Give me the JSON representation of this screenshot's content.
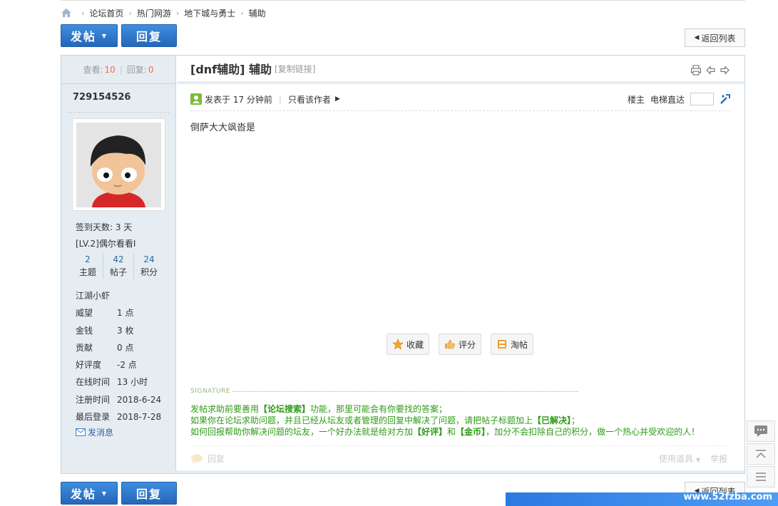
{
  "breadcrumb": [
    "论坛首页",
    "热门网游",
    "地下城与勇士",
    "辅助"
  ],
  "toolbar": {
    "post_label": "发帖",
    "reply_label": "回复",
    "back_label": "返回列表"
  },
  "stats": {
    "views_label": "查看:",
    "views": "10",
    "replies_label": "回复:",
    "replies": "0"
  },
  "author": {
    "name": "729154526",
    "sign_days": "签到天数: 3 天",
    "level": "[LV.2]偶尔看看I",
    "counts": [
      {
        "value": "2",
        "label": "主题"
      },
      {
        "value": "42",
        "label": "帖子"
      },
      {
        "value": "24",
        "label": "积分"
      }
    ],
    "rank": "江湖小虾",
    "fields": [
      {
        "k": "威望",
        "v": "1 点"
      },
      {
        "k": "金钱",
        "v": "3 枚"
      },
      {
        "k": "贡献",
        "v": "0 点"
      },
      {
        "k": "好评度",
        "v": "-2 点"
      },
      {
        "k": "在线时间",
        "v": "13 小时"
      },
      {
        "k": "注册时间",
        "v": "2018-6-24"
      },
      {
        "k": "最后登录",
        "v": "2018-7-28"
      }
    ],
    "message_label": "发消息"
  },
  "post": {
    "title_tag": "[dnf辅助]",
    "title": "辅助",
    "copy_link": "[复制链接]",
    "posted": "发表于 17 分钟前",
    "only_author": "只看该作者",
    "floor": "楼主",
    "elevator": "电梯直达",
    "content": "倒萨大大飒沓是"
  },
  "actions": {
    "favorite": "收藏",
    "rate": "评分",
    "share": "淘帖"
  },
  "signature": {
    "label": "SIGNATURE",
    "line1_a": "发帖求助前要善用",
    "line1_b": "【论坛搜索】",
    "line1_c": "功能，那里可能会有你要找的答案；",
    "line2_a": "如果你在论坛求助问题，并且已经从坛友或者管理的回复中解决了问题，请把帖子标题加上",
    "line2_b": "【已解决】",
    "line2_c": "；",
    "line3_a": "如何回报帮助你解决问题的坛友，一个好办法就是给对方加",
    "line3_b": "【好评】",
    "line3_c": "和",
    "line3_d": "【金币】",
    "line3_e": "，加分不会扣除自己的积分，做一个热心并受欢迎的人！"
  },
  "footer": {
    "reply": "回复",
    "tools": "使用道具",
    "report": "举报"
  },
  "watermark": "www.52fzba.com"
}
